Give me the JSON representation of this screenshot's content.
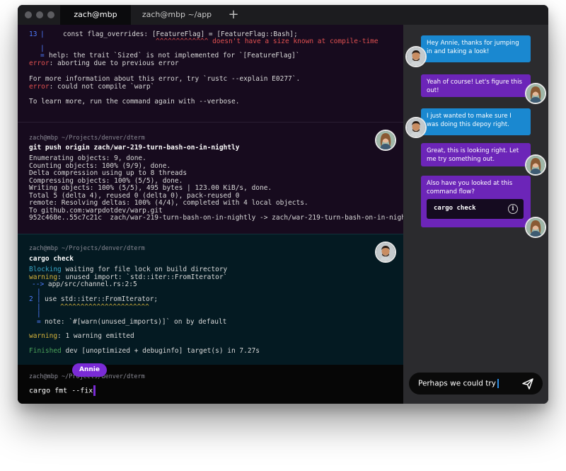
{
  "tabs": [
    {
      "label": "zach@mbp"
    },
    {
      "label": "zach@mbp ~/app"
    }
  ],
  "new_tab_label": "+",
  "blocks": {
    "error": {
      "line_number": "13",
      "code": "const flag_overrides: [FeatureFlag] = [FeatureFlag::Bash];",
      "carets": "^^^^^^^^^^^^^ doesn't have a size known at compile-time",
      "pipe": "|",
      "help_eq": "=",
      "help": "help: the trait `Sized` is not implemented for `[FeatureFlag]`",
      "error_label_1": "error",
      "error_text_1": ": aborting due to previous error",
      "more_info": "For more information about this error, try `rustc --explain E0277`.",
      "error_label_2": "error",
      "error_text_2": ": could not compile `warp`",
      "learn_more": "To learn more, run the command again with --verbose."
    },
    "push": {
      "prompt": "zach@mbp ~/Projects/denver/dterm",
      "command": "git push origin zach/war-219-turn-bash-on-in-nightly",
      "output": [
        "Enumerating objects: 9, done.",
        "Counting objects: 100% (9/9), done.",
        "Delta compression using up to 8 threads",
        "Compressing objects: 100% (5/5), done.",
        "Writing objects: 100% (5/5), 495 bytes | 123.00 KiB/s, done.",
        "Total 5 (delta 4), reused 0 (delta 0), pack-reused 0",
        "remote: Resolving deltas: 100% (4/4), completed with 4 local objects.",
        "To github.com:warpdotdev/warp.git",
        "952c468e..55c7c21c  zach/war-219-turn-bash-on-in-nightly -> zach/war-219-turn-bash-on-in-nightly"
      ]
    },
    "cargo": {
      "prompt": "zach@mbp ~/Projects/denver/dterm",
      "command": "cargo check",
      "blocking_label": "Blocking",
      "blocking_text": " waiting for file lock on build directory",
      "warning_label": "warning",
      "warning_text": ": unused import: `std::iter::FromIterator`",
      "arrow": "-->",
      "location": " app/src/channel.rs:2:5",
      "pipe": "|",
      "line_number": "2",
      "code": "use std::iter::FromIterator;",
      "carets": "^^^^^^^^^^^^^^^^^^^^^^",
      "note_eq": "=",
      "note": "note: `#[warn(unused_imports)]` on by default",
      "warning_label_2": "warning",
      "warning_text_2": ": 1 warning emitted",
      "finished_label": "Finished",
      "finished_text": " dev [unoptimized + debuginfo] target(s) in 7.27s"
    },
    "active": {
      "prompt": "zach@mbp ~/Projects/denver/dterm",
      "command": "cargo fmt --fix",
      "collaborator_tag": "Annie"
    }
  },
  "chat": {
    "messages": [
      {
        "text": "Hey Annie, thanks for jumping in and taking a look!",
        "sender": "zach"
      },
      {
        "text": "Yeah of course! Let's figure this out!",
        "sender": "annie"
      },
      {
        "text": "I just wanted to make sure I was doing this depoy right.",
        "sender": "zach"
      },
      {
        "text": "Great, this is looking right. Let me try something out.",
        "sender": "annie"
      },
      {
        "text": "Also have you looked at this command flow?",
        "sender": "annie",
        "attachment": "cargo check"
      }
    ],
    "input_value": "Perhaps we could try",
    "send_icon": "send-icon",
    "info_icon": "info-icon",
    "info_glyph": "i"
  },
  "colors": {
    "zach_bubble": "#1a88d0",
    "annie_bubble": "#6c25b8",
    "cursor": "#7a2bd6",
    "error": "#e05050",
    "warning": "#d6b33a",
    "finished": "#4aa35a"
  }
}
